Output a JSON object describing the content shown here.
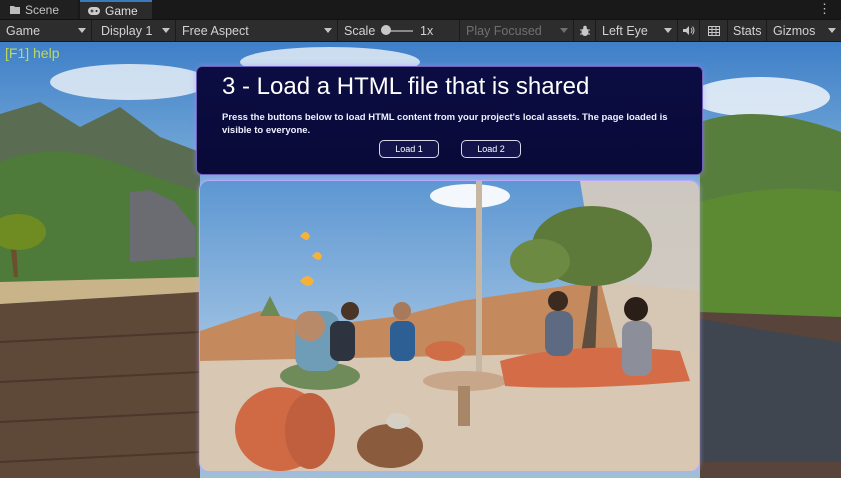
{
  "tabs": {
    "scene": "Scene",
    "game": "Game"
  },
  "toolbar": {
    "view_select": "Game",
    "display": "Display 1",
    "aspect": "Free Aspect",
    "scale_label": "Scale",
    "scale_value": "1x",
    "play_mode": "Play Focused",
    "eye": "Left Eye",
    "stats": "Stats",
    "gizmos": "Gizmos"
  },
  "view": {
    "help": "[F1] help",
    "title": "3 - Load a HTML file that is shared",
    "description": "Press the buttons below to load HTML content from your project's local assets. The page loaded is visible to everyone.",
    "load1": "Load 1",
    "load2": "Load 2"
  },
  "colors": {
    "panel": "#0b0c42",
    "accent": "#3a79bb",
    "help": "#cfe84c"
  },
  "icons": [
    "scene-icon",
    "gamepad-icon",
    "bug-icon",
    "speaker-icon",
    "grid-icon",
    "more-vertical-icon"
  ]
}
